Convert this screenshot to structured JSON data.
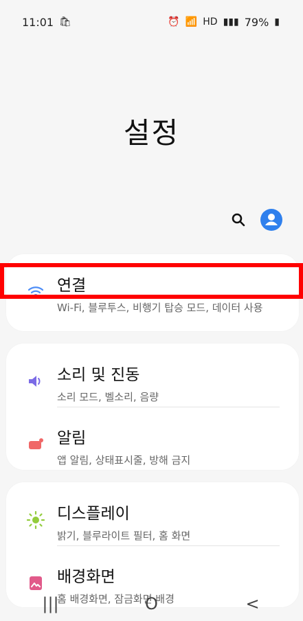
{
  "status_bar": {
    "time": "11:01",
    "battery": "79%",
    "network": "HD"
  },
  "page": {
    "title": "설정"
  },
  "top_actions": {
    "search_icon": "search-icon",
    "profile_icon": "profile-icon"
  },
  "items": [
    {
      "title": "연결",
      "subtitle": "Wi-Fi, 블루투스, 비행기 탑승 모드, 데이터 사용",
      "icon": "wifi-icon",
      "icon_color": "#4f8ef7"
    },
    {
      "title": "소리 및 진동",
      "subtitle": "소리 모드, 벨소리, 음량",
      "icon": "sound-icon",
      "icon_color": "#7b6be6"
    },
    {
      "title": "알림",
      "subtitle": "앱 알림, 상태표시줄, 방해 금지",
      "icon": "notification-icon",
      "icon_color": "#f06767"
    },
    {
      "title": "디스플레이",
      "subtitle": "밝기, 블루라이트 필터, 홈 화면",
      "icon": "display-icon",
      "icon_color": "#93cc3d"
    },
    {
      "title": "배경화면",
      "subtitle": "홈 배경화면, 잠금화면 배경",
      "icon": "wallpaper-icon",
      "icon_color": "#e15a8a"
    }
  ],
  "nav_bar": {
    "recents": "|||",
    "home": "O",
    "back": "<"
  }
}
